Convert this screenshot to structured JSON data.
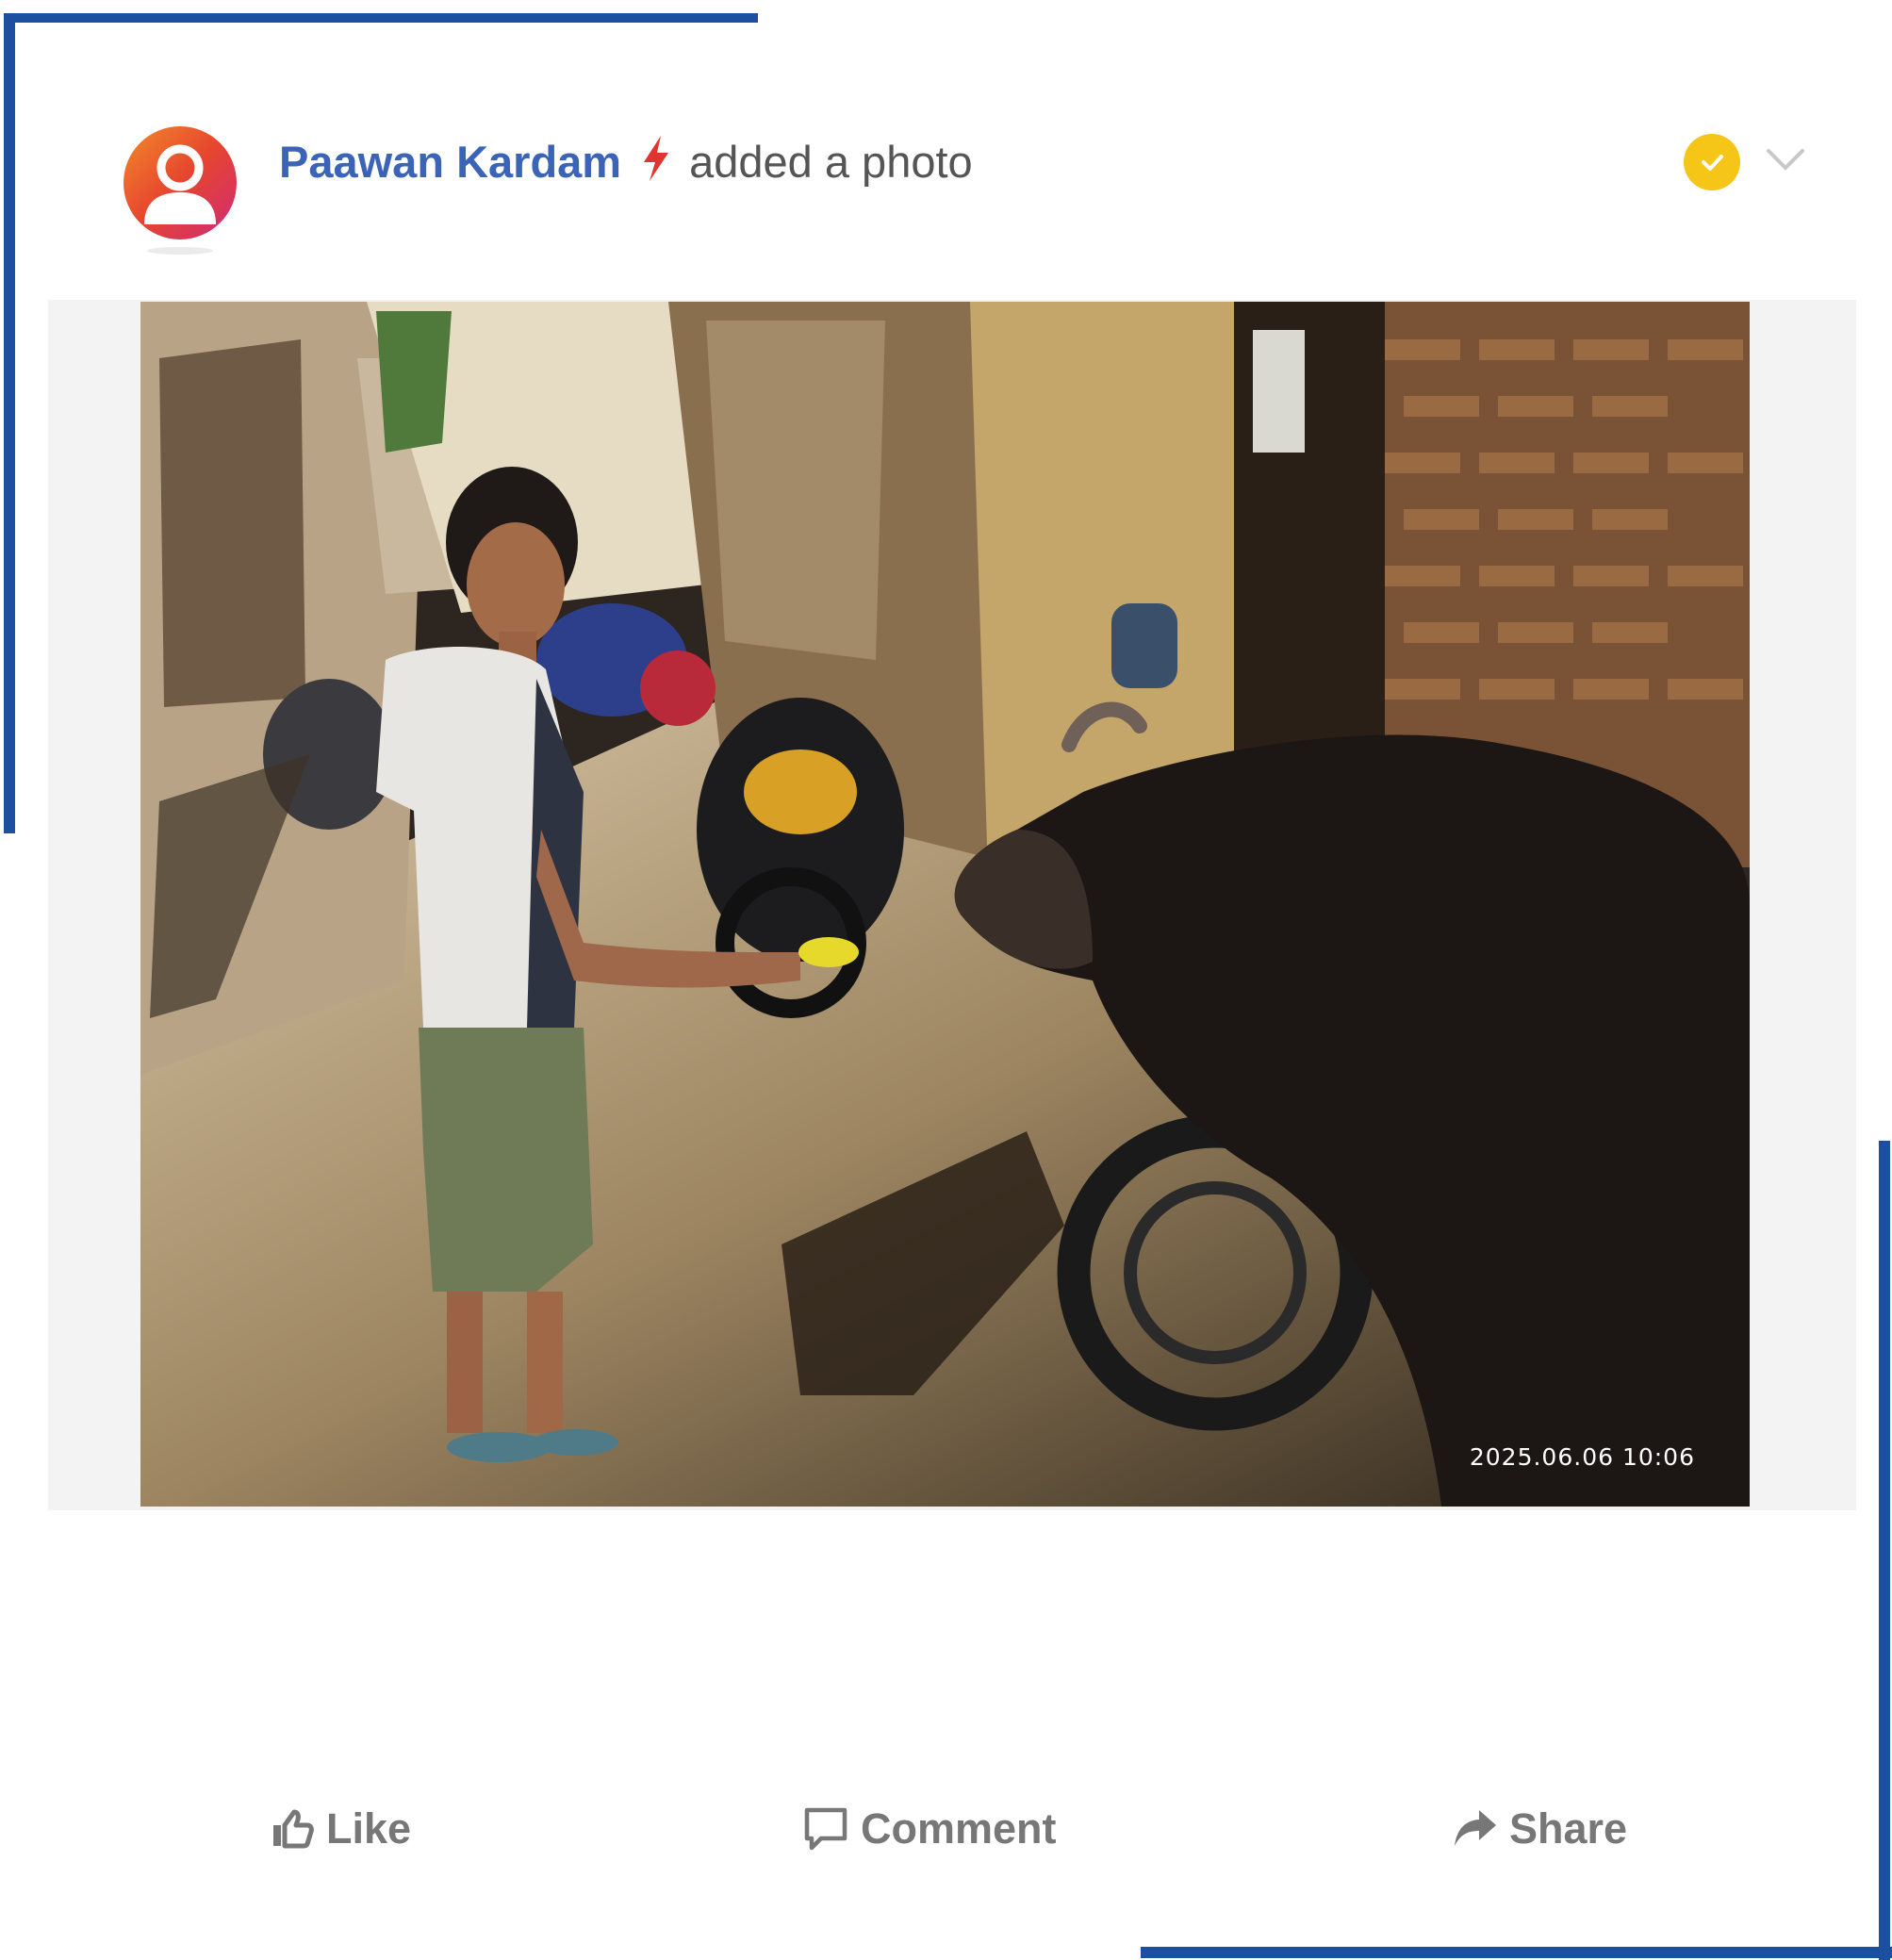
{
  "post": {
    "author_name": "Paawan Kardam",
    "action_text": "added a photo",
    "photo_timestamp": "2025.06.06 10:06"
  },
  "actions": {
    "like_label": "Like",
    "comment_label": "Comment",
    "share_label": "Share"
  },
  "icons": {
    "header": [
      "user-avatar-icon",
      "lightning-bolt-icon",
      "verified-check-icon",
      "chevron-down-icon"
    ],
    "actions": [
      "thumbs-up-icon",
      "comment-bubble-icon",
      "share-arrow-icon"
    ]
  },
  "colors": {
    "accent_blue": "#3b63b8",
    "frame_blue": "#1d4fa0",
    "bolt_red": "#e0342f",
    "verified_yellow": "#f5c518",
    "action_gray": "#777777"
  }
}
